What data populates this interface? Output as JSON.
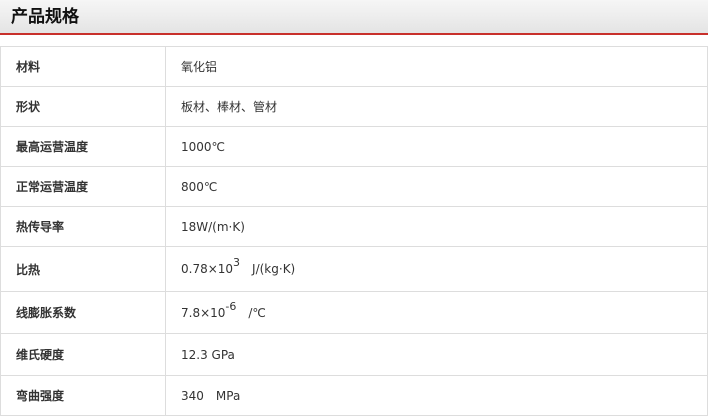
{
  "header": {
    "title": "产品规格"
  },
  "specs": [
    {
      "label": "材料",
      "value": "氧化铝"
    },
    {
      "label": "形状",
      "value": "板材、棒材、管材"
    },
    {
      "label": "最高运营温度",
      "value": "1000℃"
    },
    {
      "label": "正常运营温度",
      "value": "800℃"
    },
    {
      "label": "热传导率",
      "value": "18W/(m·K)"
    },
    {
      "label": "比热",
      "value_base": "0.78×10",
      "value_exp": "3",
      "value_unit": "J/(kg·K)"
    },
    {
      "label": "线膨胀系数",
      "value_base": "7.8×10",
      "value_exp": "-6",
      "value_unit": "/℃"
    },
    {
      "label": "维氏硬度",
      "value": "12.3 GPa"
    },
    {
      "label": "弯曲强度",
      "value": "340　MPa"
    }
  ]
}
